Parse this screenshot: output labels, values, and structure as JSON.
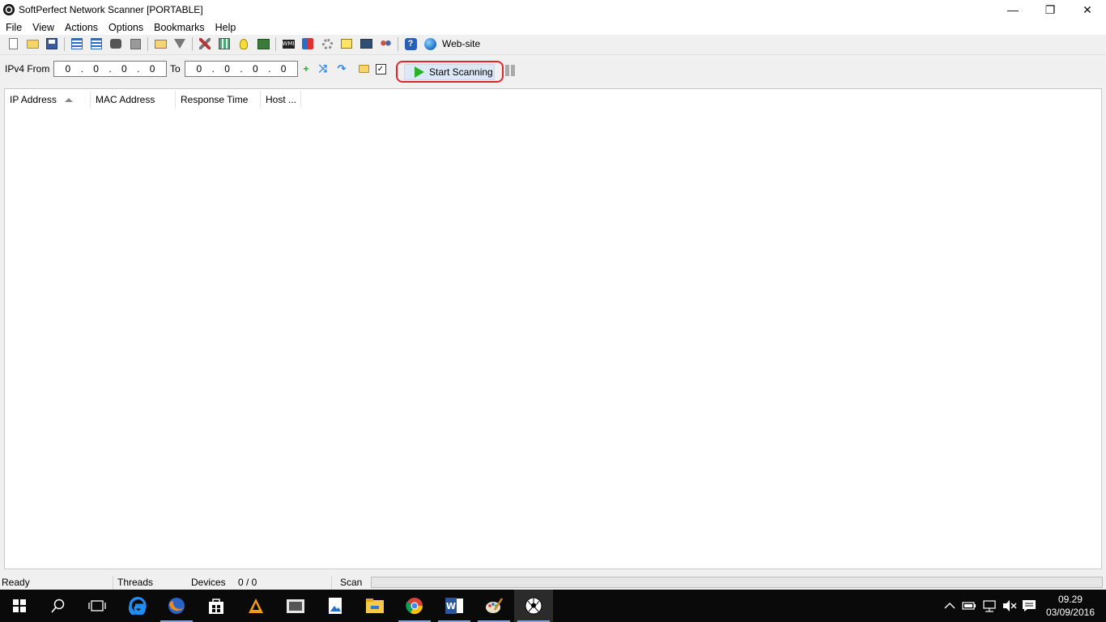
{
  "window": {
    "title": "SoftPerfect Network Scanner [PORTABLE]",
    "minimize": "—",
    "restore": "❐",
    "close": "✕"
  },
  "menu": [
    "File",
    "View",
    "Actions",
    "Options",
    "Bookmarks",
    "Help"
  ],
  "toolbar": {
    "website_label": "Web-site"
  },
  "range": {
    "from_label": "IPv4 From",
    "from_octets": [
      "0",
      "0",
      "0",
      "0"
    ],
    "to_label": "To",
    "to_octets": [
      "0",
      "0",
      "0",
      "0"
    ],
    "dot": ".",
    "start_label": "Start Scanning"
  },
  "columns": [
    "IP Address",
    "MAC Address",
    "Response Time",
    "Host ..."
  ],
  "status": {
    "state": "Ready",
    "threads_label": "Threads",
    "devices_label": "Devices",
    "devices_value": "0 / 0",
    "scan_label": "Scan",
    "scan_progress": 0
  },
  "taskbar": {
    "time": "09.29",
    "date": "03/09/2016"
  },
  "colors": {
    "highlight_ring": "#e0252b",
    "start_icon": "#2ab12a",
    "taskbar_bg": "#0a0a0a"
  }
}
